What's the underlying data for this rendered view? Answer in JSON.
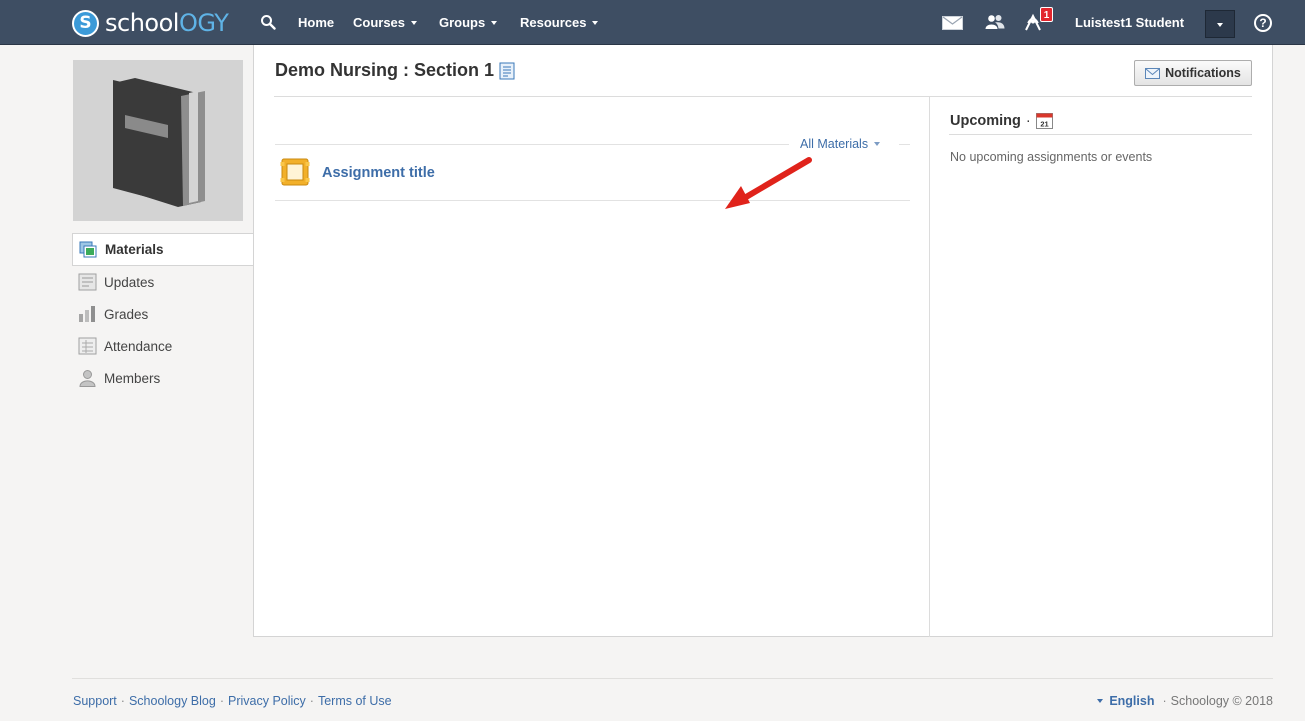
{
  "nav": {
    "logo_main": "schoo",
    "logo_accent": "OGY",
    "logo_letter": "S",
    "logo_l": "l",
    "home": "Home",
    "courses": "Courses",
    "groups": "Groups",
    "resources": "Resources",
    "notification_count": "1",
    "user_name": "Luistest1 Student",
    "help": "?"
  },
  "sidebar": {
    "items": [
      {
        "label": "Materials",
        "icon": "materials-icon",
        "active": true
      },
      {
        "label": "Updates",
        "icon": "updates-icon"
      },
      {
        "label": "Grades",
        "icon": "grades-icon"
      },
      {
        "label": "Attendance",
        "icon": "attendance-icon"
      },
      {
        "label": "Members",
        "icon": "members-icon"
      }
    ]
  },
  "main": {
    "title": "Demo Nursing : Section 1",
    "notifications_label": "Notifications",
    "filter_label": "All Materials",
    "assignment_title": "Assignment title"
  },
  "upcoming": {
    "heading": "Upcoming",
    "dot": "·",
    "calendar_day": "21",
    "empty": "No upcoming assignments or events"
  },
  "footer": {
    "links": [
      "Support",
      "Schoology Blog",
      "Privacy Policy",
      "Terms of Use"
    ],
    "separator": "·",
    "language": "English",
    "copyright": "Schoology © 2018"
  },
  "colors": {
    "nav_bg": "#3e4e63",
    "link": "#3d6da8",
    "accent_blue": "#3b9ad8",
    "arrow_red": "#e0231b",
    "badge_red": "#e2262e"
  }
}
